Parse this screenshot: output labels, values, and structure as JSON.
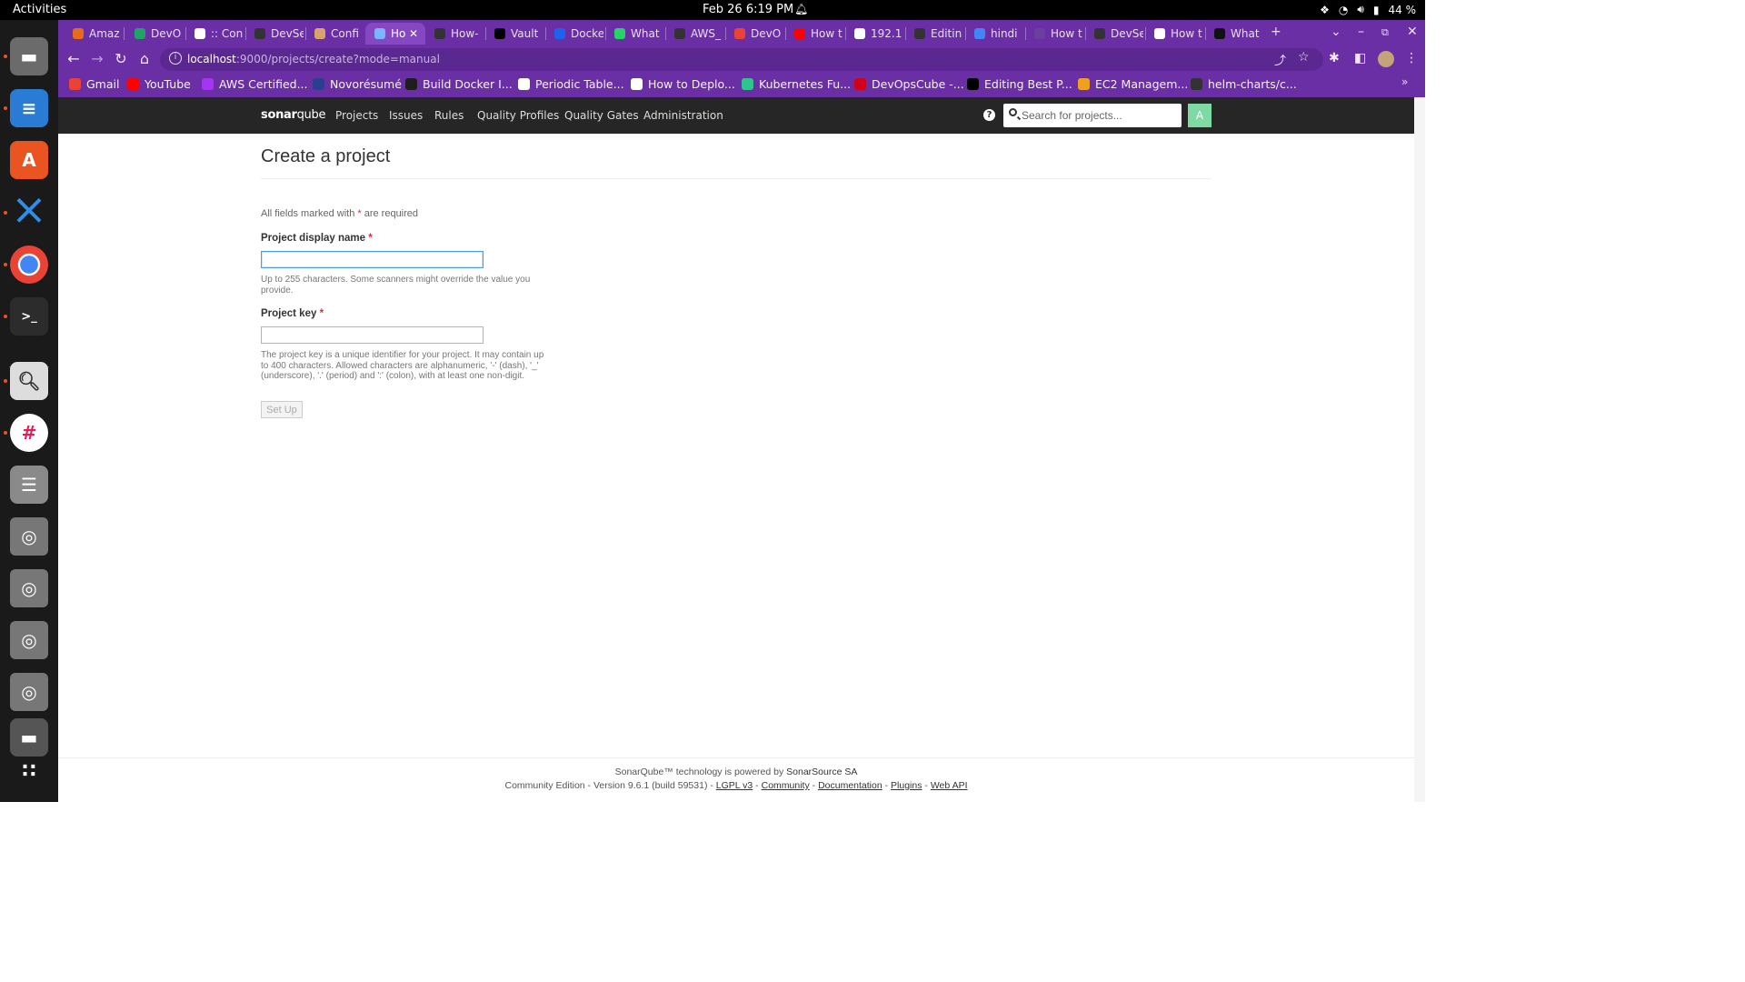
{
  "system": {
    "activities": "Activities",
    "clock": "Feb 26  6:19 PM",
    "battery": "44 %"
  },
  "tabs": [
    {
      "label": "Amaz",
      "color": "#e46c1a"
    },
    {
      "label": "DevO",
      "color": "#21a366"
    },
    {
      "label": ":: Con",
      "color": "#ffffff"
    },
    {
      "label": "DevSe",
      "color": "#333333"
    },
    {
      "label": "Confi",
      "color": "#d7a56a"
    },
    {
      "label": "Ho",
      "color": "#7ab6ff",
      "active": true
    },
    {
      "label": "How-",
      "color": "#333333"
    },
    {
      "label": "Vault",
      "color": "#000000"
    },
    {
      "label": "Docke",
      "color": "#1d63ed"
    },
    {
      "label": "What",
      "color": "#25d366"
    },
    {
      "label": "AWS_",
      "color": "#333333"
    },
    {
      "label": "DevO",
      "color": "#ea4335"
    },
    {
      "label": "How t",
      "color": "#ff0000"
    },
    {
      "label": "192.1",
      "color": "#ffffff"
    },
    {
      "label": "Editin",
      "color": "#333333"
    },
    {
      "label": "hindi",
      "color": "#4285f4"
    },
    {
      "label": "How t",
      "color": "#6a3fa0"
    },
    {
      "label": "DevSe",
      "color": "#333333"
    },
    {
      "label": "How t",
      "color": "#ffffff"
    },
    {
      "label": "What",
      "color": "#111111"
    }
  ],
  "url": {
    "host": "localhost",
    "rest": ":9000/projects/create?mode=manual"
  },
  "bookmarks": [
    {
      "label": "Gmail",
      "color": "#ea4335"
    },
    {
      "label": "YouTube",
      "color": "#ff0000"
    },
    {
      "label": "AWS Certified...",
      "color": "#a435f0"
    },
    {
      "label": "Novorésumé",
      "color": "#2c3e8f"
    },
    {
      "label": "Build Docker I...",
      "color": "#1e1e1e"
    },
    {
      "label": "Periodic Table...",
      "color": "#ffffff"
    },
    {
      "label": "How to Deplo...",
      "color": "#ffffff"
    },
    {
      "label": "Kubernetes Fu...",
      "color": "#30c48d"
    },
    {
      "label": "DevOpsCube -...",
      "color": "#d0021b"
    },
    {
      "label": "Editing Best P...",
      "color": "#000000"
    },
    {
      "label": "EC2 Managem...",
      "color": "#f0a020"
    },
    {
      "label": "helm-charts/c...",
      "color": "#333333"
    }
  ],
  "sonarqube": {
    "logo_bold": "sonar",
    "logo_rest": "qube",
    "nav": [
      "Projects",
      "Issues",
      "Rules",
      "Quality Profiles",
      "Quality Gates",
      "Administration"
    ],
    "help": "?",
    "search_placeholder": "Search for projects...",
    "avatar_letter": "A"
  },
  "form": {
    "title": "Create a project",
    "required_note_before": "All fields marked with ",
    "required_star": "*",
    "required_note_after": " are required",
    "display_name_label": "Project display name",
    "display_name_value": "",
    "display_name_help": "Up to 255 characters. Some scanners might override the value you provide.",
    "key_label": "Project key",
    "key_value": "",
    "key_help": "The project key is a unique identifier for your project. It may contain up to 400 characters. Allowed characters are alphanumeric, '-' (dash), '_' (underscore), '.' (period) and ':' (colon), with at least one non-digit.",
    "submit": "Set Up"
  },
  "footer": {
    "line1_text": "SonarQube™ technology is powered by ",
    "line1_link": "SonarSource SA",
    "edition": "Community Edition - Version 9.6.1 (build 59531) - ",
    "links": [
      "LGPL v3",
      "Community",
      "Documentation",
      "Plugins",
      "Web API"
    ]
  }
}
